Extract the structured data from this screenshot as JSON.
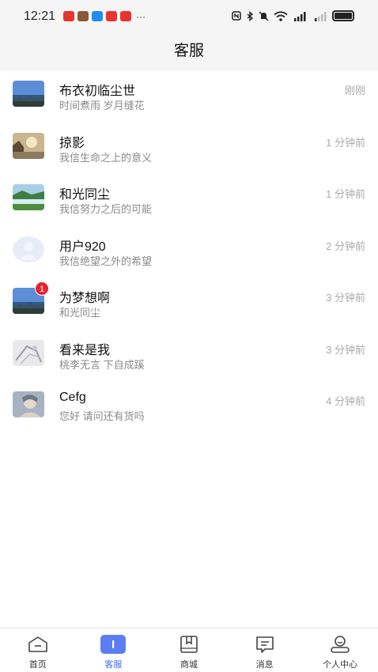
{
  "status_bar": {
    "time": "12:21",
    "more": "···",
    "notif_colors": [
      "#e8332e",
      "#8a5a3b",
      "#1e8ef0",
      "#e8332e",
      "#e8332e"
    ]
  },
  "header": {
    "title": "客服"
  },
  "conversations": [
    {
      "name": "布衣初临尘世",
      "message": "时间煮雨 岁月缝花",
      "time": "刚刚",
      "avatar": "sky-landscape-avatar",
      "badge": ""
    },
    {
      "name": "掠影",
      "message": "我信生命之上的意义",
      "time": "1 分钟前",
      "avatar": "sunset-landscape-avatar",
      "badge": ""
    },
    {
      "name": "和光同尘",
      "message": "我信努力之后的可能",
      "time": "1 分钟前",
      "avatar": "green-landscape-avatar",
      "badge": ""
    },
    {
      "name": "用户920",
      "message": "我信绝望之外的希望",
      "time": "2 分钟前",
      "avatar": "default-avatar",
      "badge": ""
    },
    {
      "name": "为梦想啊",
      "message": "和光同尘",
      "time": "3 分钟前",
      "avatar": "sky-landscape-avatar",
      "badge": "1"
    },
    {
      "name": "看来是我",
      "message": "桃李无言 下自成蹊",
      "time": "3 分钟前",
      "avatar": "sketch-avatar",
      "badge": ""
    },
    {
      "name": "Cefg",
      "message": "您好 请问还有货吗",
      "time": "4 分钟前",
      "avatar": "portrait-avatar",
      "badge": ""
    }
  ],
  "tabbar": {
    "active_color": "#3d6af0",
    "items": [
      {
        "label": "首页",
        "icon": "home-icon"
      },
      {
        "label": "客服",
        "icon": "service-icon"
      },
      {
        "label": "商城",
        "icon": "mall-icon"
      },
      {
        "label": "消息",
        "icon": "message-icon"
      },
      {
        "label": "个人中心",
        "icon": "profile-icon"
      }
    ]
  }
}
